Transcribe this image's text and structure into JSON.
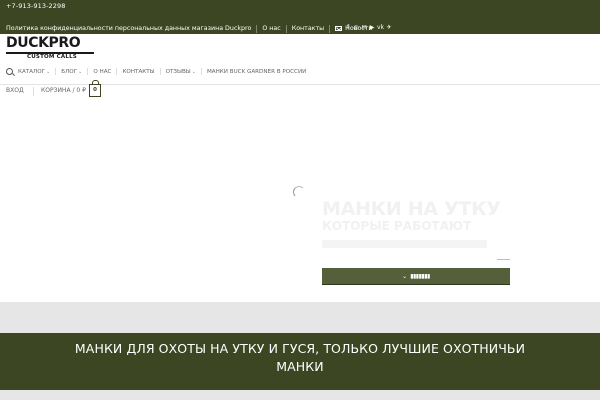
{
  "topbar": {
    "phone": "+7-913-913-2298",
    "links": {
      "privacy": "Политика конфиденциальности персональных данных магазина Duckpro",
      "about": "О нас",
      "contacts": "Контакты",
      "news": "Новости"
    },
    "social_icons": [
      "facebook-icon",
      "instagram-icon",
      "email-icon",
      "youtube-icon",
      "vk-icon",
      "telegram-icon"
    ],
    "social_glyphs": {
      "facebook": "f",
      "instagram": "◎",
      "email": "✉",
      "youtube": "▶",
      "vk": "vk",
      "telegram": "✈"
    }
  },
  "logo": {
    "main": "DUCKPRO",
    "sub": "CUSTOM CALLS"
  },
  "nav": {
    "items": [
      {
        "label": "КАТАЛОГ",
        "chevron": "⌄"
      },
      {
        "label": "БЛОГ",
        "chevron": "⌄"
      },
      {
        "label": "О НАС",
        "chevron": ""
      },
      {
        "label": "КОНТАКТЫ",
        "chevron": ""
      },
      {
        "label": "ОТЗЫВЫ",
        "chevron": "⌄"
      },
      {
        "label": "МАНКИ BUCK GARDNER В РОССИИ",
        "chevron": ""
      }
    ]
  },
  "utility": {
    "login": "ВХОД",
    "cart": "КОРЗИНА / 0 ₽",
    "cart_count": "0"
  },
  "hero": {
    "title1": "МАНКИ НА УТКУ",
    "title2": "КОТОРЫЕ РАБОТАЮТ",
    "button_chevron": "⌄",
    "button_label": "▮▮▮▮▮▮▮"
  },
  "banner": {
    "text": "МАНКИ ДЛЯ ОХОТЫ НА УТКУ И ГУСЯ, ТОЛЬКО ЛУЧШИЕ ОХОТНИЧЬИ МАНКИ"
  },
  "colors": {
    "brand_green": "#3c4623",
    "button_green": "#555f3a"
  }
}
